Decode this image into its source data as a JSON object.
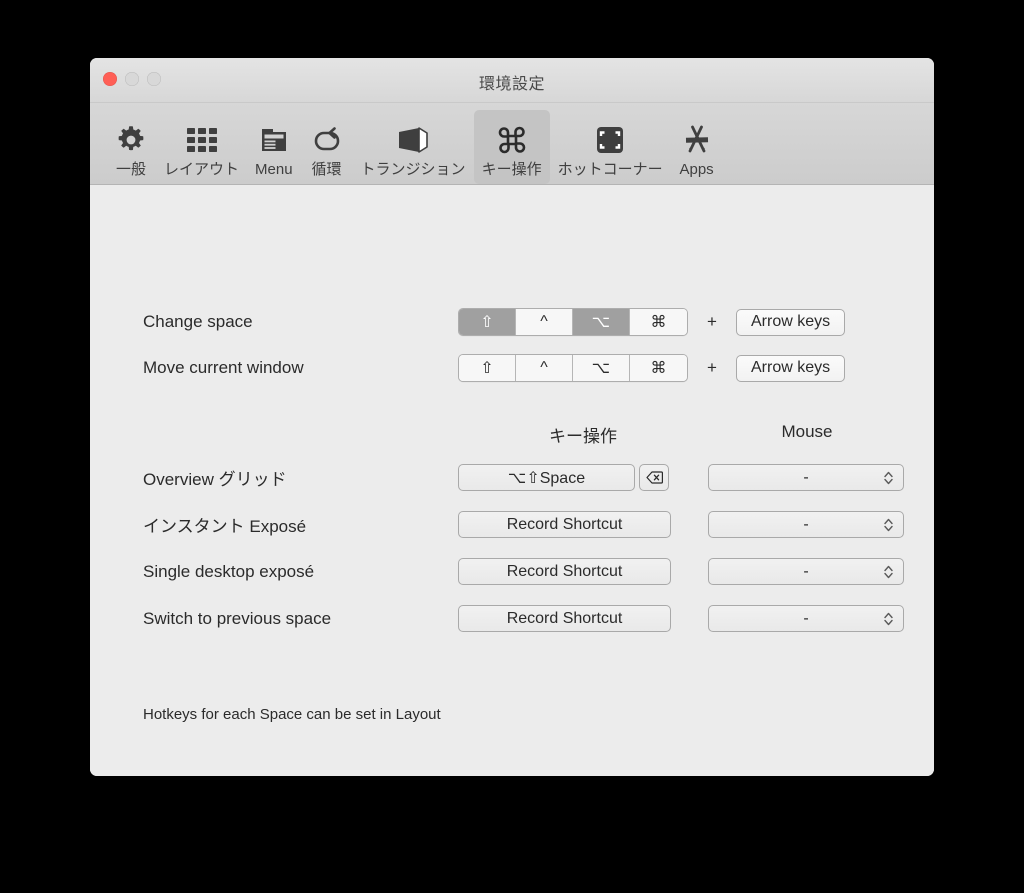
{
  "window": {
    "title": "環境設定",
    "traffic_lights": [
      {
        "name": "close",
        "color": "#ff5f56"
      },
      {
        "name": "minimize",
        "color": "#d8d8d8"
      },
      {
        "name": "zoom",
        "color": "#d8d8d8"
      }
    ]
  },
  "toolbar": {
    "items": [
      {
        "label": "一般",
        "icon": "gear-icon",
        "selected": false
      },
      {
        "label": "レイアウト",
        "icon": "grid-icon",
        "selected": false
      },
      {
        "label": "Menu",
        "icon": "menu-window-icon",
        "selected": false
      },
      {
        "label": "循環",
        "icon": "loop-arrow-icon",
        "selected": false
      },
      {
        "label": "トランジション",
        "icon": "cube-icon",
        "selected": false
      },
      {
        "label": "キー操作",
        "icon": "command-icon",
        "selected": true
      },
      {
        "label": "ホットコーナー",
        "icon": "hot-corners-icon",
        "selected": false
      },
      {
        "label": "Apps",
        "icon": "app-store-icon",
        "selected": false
      }
    ]
  },
  "modifier_rows": [
    {
      "label": "Change space",
      "segments": [
        {
          "glyph": "⇧",
          "name": "shift",
          "selected": true
        },
        {
          "glyph": "^",
          "name": "control",
          "selected": false
        },
        {
          "glyph": "⌥",
          "name": "option",
          "selected": true
        },
        {
          "glyph": "⌘",
          "name": "command",
          "selected": false
        }
      ],
      "plus": "+",
      "button": "Arrow keys"
    },
    {
      "label": "Move current window",
      "segments": [
        {
          "glyph": "⇧",
          "name": "shift",
          "selected": false
        },
        {
          "glyph": "^",
          "name": "control",
          "selected": false
        },
        {
          "glyph": "⌥",
          "name": "option",
          "selected": false
        },
        {
          "glyph": "⌘",
          "name": "command",
          "selected": false
        }
      ],
      "plus": "+",
      "button": "Arrow keys"
    }
  ],
  "columns": {
    "shortcut": "キー操作",
    "mouse": "Mouse"
  },
  "shortcut_rows": [
    {
      "label": "Overview グリッド",
      "shortcut": "⌥⇧Space",
      "recorded": true,
      "has_clear": true,
      "mouse": "-"
    },
    {
      "label": "インスタント Exposé",
      "shortcut": "Record Shortcut",
      "recorded": false,
      "has_clear": false,
      "mouse": "-"
    },
    {
      "label": "Single desktop exposé",
      "shortcut": "Record Shortcut",
      "recorded": false,
      "has_clear": false,
      "mouse": "-"
    },
    {
      "label": "Switch to previous space",
      "shortcut": "Record Shortcut",
      "recorded": false,
      "has_clear": false,
      "mouse": "-"
    }
  ],
  "footnote": "Hotkeys for each Space can be set in Layout"
}
